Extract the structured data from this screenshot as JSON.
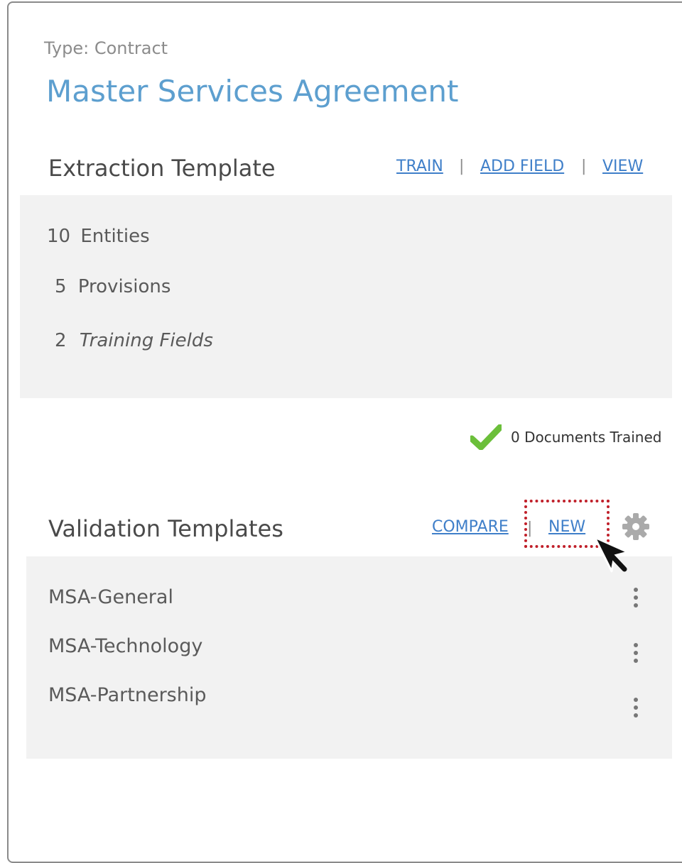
{
  "card": {
    "type_label": "Type: Contract",
    "title": "Master Services Agreement"
  },
  "extraction": {
    "heading": "Extraction Template",
    "links": {
      "train": "TRAIN",
      "add_field": "ADD FIELD",
      "view": "VIEW"
    },
    "separator": "|",
    "stats": [
      {
        "count": "10",
        "label": "Entities"
      },
      {
        "count": "5",
        "label": "Provisions"
      },
      {
        "count": "2",
        "label": "Training Fields"
      }
    ],
    "status": {
      "icon": "check-icon",
      "text": "0 Documents Trained",
      "color": "#6bbf3a"
    }
  },
  "validation": {
    "heading": "Validation Templates",
    "links": {
      "compare": "COMPARE",
      "new": "NEW"
    },
    "separator": "|",
    "settings_icon": "gear-icon",
    "templates": [
      {
        "name": "MSA-General",
        "menu_icon": "more-vertical-icon"
      },
      {
        "name": "MSA-Technology",
        "menu_icon": "more-vertical-icon"
      },
      {
        "name": "MSA-Partnership",
        "menu_icon": "more-vertical-icon"
      }
    ]
  },
  "annotation": {
    "highlight_color": "#c0202a",
    "cursor_icon": "pointer-cursor-icon"
  },
  "colors": {
    "title": "#5d9fcf",
    "link": "#3f7fc9",
    "panel_bg": "#f2f2f2"
  }
}
